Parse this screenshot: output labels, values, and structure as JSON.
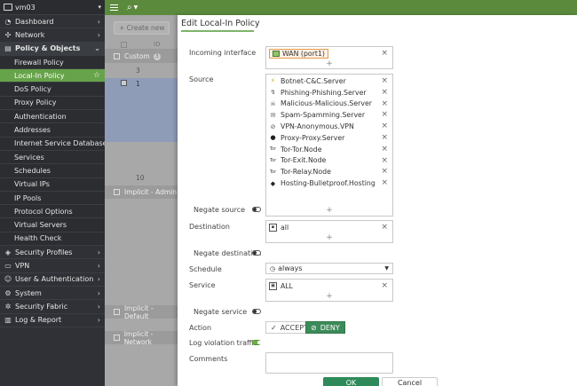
{
  "sidebar": {
    "device": "vm03",
    "items": [
      {
        "label": "Dashboard",
        "type": "section",
        "icon": "dashboard-icon",
        "glyph": "◔",
        "arrow": "›"
      },
      {
        "label": "Network",
        "type": "section",
        "icon": "network-icon",
        "glyph": "✣",
        "arrow": "›"
      },
      {
        "label": "Policy & Objects",
        "type": "section-open",
        "icon": "policy-icon",
        "glyph": "▤",
        "arrow": "⌄"
      },
      {
        "label": "Firewall Policy",
        "type": "sub"
      },
      {
        "label": "Local-In Policy",
        "type": "sub-active"
      },
      {
        "label": "DoS Policy",
        "type": "sub"
      },
      {
        "label": "Proxy Policy",
        "type": "sub"
      },
      {
        "label": "Authentication",
        "type": "sub"
      },
      {
        "label": "Addresses",
        "type": "sub"
      },
      {
        "label": "Internet Service Database",
        "type": "sub"
      },
      {
        "label": "Services",
        "type": "sub"
      },
      {
        "label": "Schedules",
        "type": "sub"
      },
      {
        "label": "Virtual IPs",
        "type": "sub"
      },
      {
        "label": "IP Pools",
        "type": "sub"
      },
      {
        "label": "Protocol Options",
        "type": "sub"
      },
      {
        "label": "Virtual Servers",
        "type": "sub"
      },
      {
        "label": "Health Check",
        "type": "sub"
      },
      {
        "label": "Security Profiles",
        "type": "section",
        "icon": "security-profiles-icon",
        "glyph": "◈",
        "arrow": "›"
      },
      {
        "label": "VPN",
        "type": "section",
        "icon": "vpn-icon",
        "glyph": "▭",
        "arrow": "›"
      },
      {
        "label": "User & Authentication",
        "type": "section",
        "icon": "user-icon",
        "glyph": "☺",
        "arrow": "›"
      },
      {
        "label": "System",
        "type": "section",
        "icon": "system-icon",
        "glyph": "⚙",
        "arrow": "›"
      },
      {
        "label": "Security Fabric",
        "type": "section",
        "icon": "security-fabric-icon",
        "glyph": "✲",
        "arrow": "›"
      },
      {
        "label": "Log & Report",
        "type": "section",
        "icon": "log-report-icon",
        "glyph": "▥",
        "arrow": "›"
      }
    ]
  },
  "behind": {
    "create_label": "Create new",
    "id_header": "ID",
    "group_custom": "Custom",
    "group_custom_count": "3",
    "row_ids": [
      "3",
      "1"
    ],
    "row_last": "10",
    "group_admin": "Implicit - Admin",
    "group_default": "Implicit - Default",
    "group_network": "Implicit - Network"
  },
  "dialog": {
    "title": "Edit Local-In Policy",
    "incoming_label": "Incoming interface",
    "incoming_value": "WAN (port1)",
    "source_label": "Source",
    "sources": [
      {
        "label": "Botnet-C&C.Server",
        "glyph": "⚡"
      },
      {
        "label": "Phishing-Phishing.Server",
        "glyph": "↯"
      },
      {
        "label": "Malicious-Malicious.Server",
        "glyph": "☠"
      },
      {
        "label": "Spam-Spamming.Server",
        "glyph": "✉"
      },
      {
        "label": "VPN-Anonymous.VPN",
        "glyph": "⊘"
      },
      {
        "label": "Proxy-Proxy.Server",
        "glyph": "●"
      },
      {
        "label": "Tor-Tor.Node",
        "glyph": "Tor"
      },
      {
        "label": "Tor-Exit.Node",
        "glyph": "Tor"
      },
      {
        "label": "Tor-Relay.Node",
        "glyph": "Tor"
      },
      {
        "label": "Hosting-Bulletproof.Hosting",
        "glyph": "◆"
      }
    ],
    "negate_source_label": "Negate source",
    "destination_label": "Destination",
    "destination_value": "all",
    "negate_destination_label": "Negate destination",
    "schedule_label": "Schedule",
    "schedule_value": "always",
    "service_label": "Service",
    "service_value": "ALL",
    "negate_service_label": "Negate service",
    "action_label": "Action",
    "accept_label": "ACCEPT",
    "deny_label": "DENY",
    "log_label": "Log violation traffic",
    "comments_label": "Comments",
    "ok_label": "OK",
    "cancel_label": "Cancel",
    "plus": "+",
    "remove": "×"
  },
  "colors": {
    "accent": "#5c8a3d",
    "active_nav": "#67a34a",
    "deny": "#3d8a5a",
    "ok": "#2f8a5a",
    "wan_border": "#e69a4a"
  }
}
